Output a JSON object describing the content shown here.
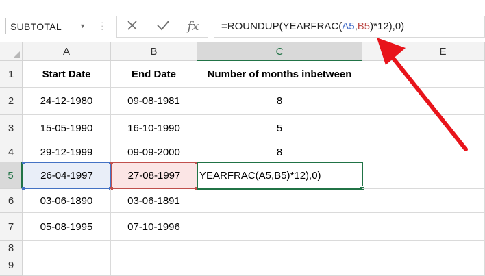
{
  "formula_bar": {
    "name_box": "SUBTOTAL",
    "cancel_icon": "close-icon",
    "enter_icon": "check-icon",
    "function_icon": "fx",
    "formula_prefix": "=ROUNDUP(YEARFRAC(",
    "formula_ref_a": "A5",
    "formula_comma": ",",
    "formula_ref_b": "B5",
    "formula_suffix": ")*12),0)"
  },
  "columns": [
    "A",
    "B",
    "C",
    "",
    "E"
  ],
  "rows": [
    "1",
    "2",
    "3",
    "4",
    "5",
    "6",
    "7",
    "8",
    "9"
  ],
  "headers": {
    "start_date": "Start Date",
    "end_date": "End Date",
    "months": "Number of months inbetween"
  },
  "data_rows": [
    {
      "start": "24-12-1980",
      "end": "09-08-1981",
      "months": "8"
    },
    {
      "start": "15-05-1990",
      "end": "16-10-1990",
      "months": "5"
    },
    {
      "start": "29-12-1999",
      "end": "09-09-2000",
      "months": "8"
    },
    {
      "start": "26-04-1997",
      "end": "27-08-1997",
      "months": "YEARFRAC(A5,B5)*12),0)"
    },
    {
      "start": "03-06-1890",
      "end": "03-06-1891",
      "months": ""
    },
    {
      "start": "05-08-1995",
      "end": "07-10-1996",
      "months": ""
    }
  ],
  "colors": {
    "accent_green": "#217346",
    "ref_a_blue": "#4472c4",
    "ref_b_red": "#c0504d",
    "arrow_red": "#e8141b"
  }
}
